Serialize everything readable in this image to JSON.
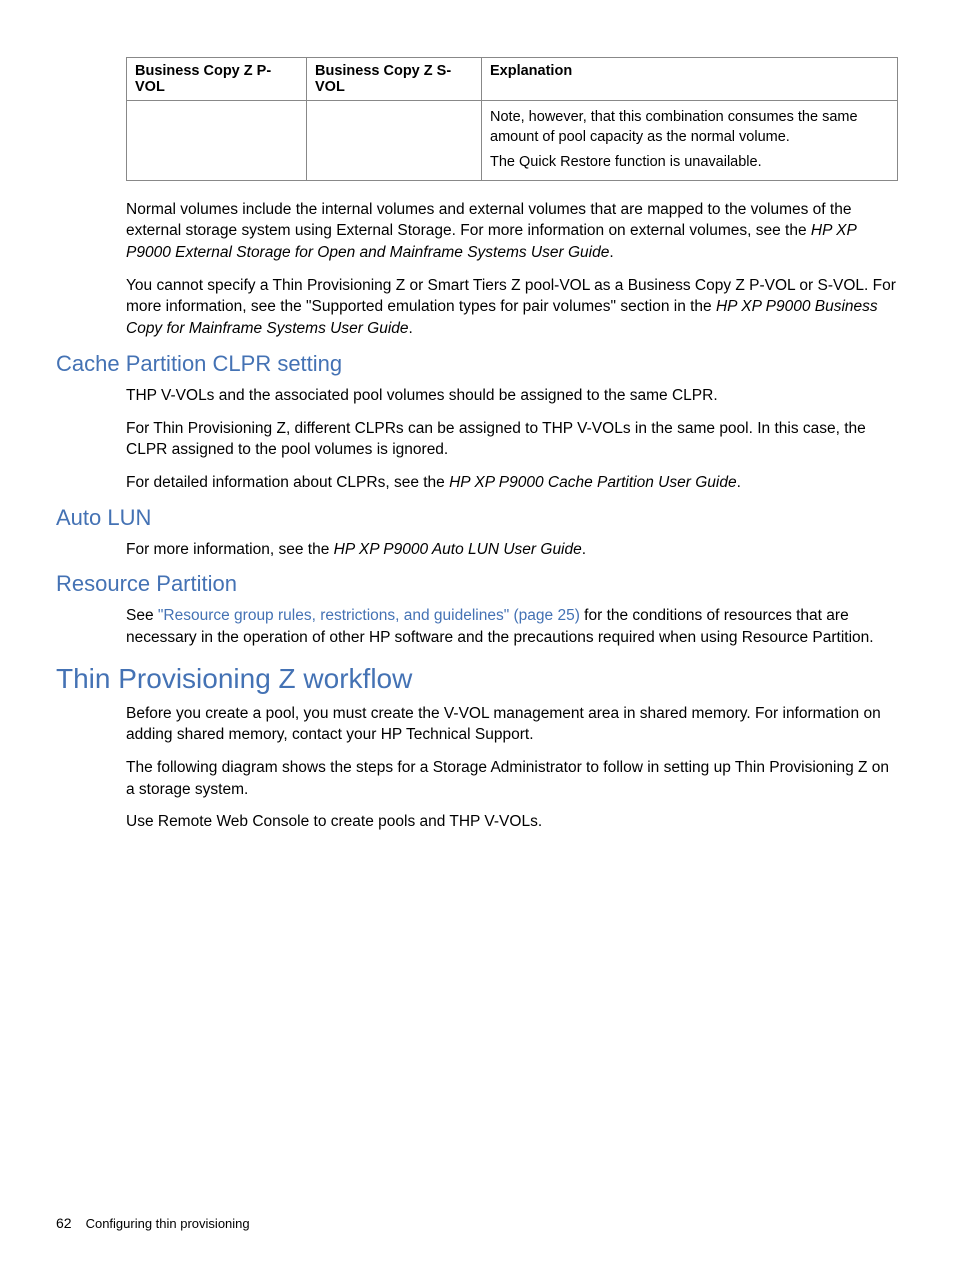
{
  "table": {
    "headers": [
      "Business Copy Z P-VOL",
      "Business Copy Z S-VOL",
      "Explanation"
    ],
    "row": {
      "c1": "",
      "c2": "",
      "exp1": "Note, however, that this combination consumes the same amount of pool capacity as the normal volume.",
      "exp2": "The Quick Restore function is unavailable."
    }
  },
  "para1": {
    "t1": "Normal volumes include the internal volumes and external volumes that are mapped to the volumes of the external storage system using External Storage. For more information on external volumes, see the ",
    "i1": "HP XP P9000 External Storage for Open and Mainframe Systems User Guide",
    "t2": "."
  },
  "para2": {
    "t1": "You cannot specify a Thin Provisioning Z or Smart Tiers Z pool-VOL as a Business Copy Z P-VOL or S-VOL. For more information, see the \"Supported emulation types for pair volumes\" section in the ",
    "i1": "HP XP P9000 Business Copy for Mainframe Systems User Guide",
    "t2": "."
  },
  "h2_cache": "Cache Partition CLPR setting",
  "cache": {
    "p1": "THP V-VOLs and the associated pool volumes should be assigned to the same CLPR.",
    "p2": "For Thin Provisioning Z, different CLPRs can be assigned to THP V-VOLs in the same pool. In this case, the CLPR assigned to the pool volumes is ignored.",
    "p3a": "For detailed information about CLPRs, see the ",
    "p3i": "HP XP P9000 Cache Partition User Guide",
    "p3b": "."
  },
  "h2_auto": "Auto LUN",
  "auto": {
    "p1a": "For more information, see the ",
    "p1i": "HP XP P9000 Auto LUN User Guide",
    "p1b": "."
  },
  "h2_resource": "Resource Partition",
  "resource": {
    "p1a": "See ",
    "link": "\"Resource group rules, restrictions, and guidelines\" (page 25)",
    "p1b": " for the conditions of resources that are necessary in the operation of other HP software and the precautions required when using Resource Partition."
  },
  "h1_workflow": "Thin Provisioning Z workflow",
  "workflow": {
    "p1": "Before you create a pool, you must create the V-VOL management area in shared memory. For information on adding shared memory, contact your HP Technical Support.",
    "p2": "The following diagram shows the steps for a Storage Administrator to follow in setting up Thin Provisioning Z on a storage system.",
    "p3": "Use Remote Web Console to create pools and THP V-VOLs."
  },
  "footer": {
    "page": "62",
    "title": "Configuring thin provisioning"
  }
}
